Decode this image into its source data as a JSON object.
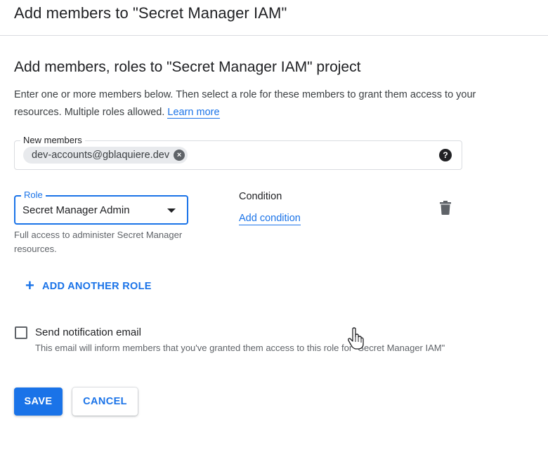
{
  "header": {
    "title": "Add members to \"Secret Manager IAM\""
  },
  "section": {
    "title": "Add members, roles to \"Secret Manager IAM\" project",
    "description": "Enter one or more members below. Then select a role for these members to grant them access to your resources. Multiple roles allowed. ",
    "learn_more": "Learn more"
  },
  "members": {
    "label": "New members",
    "chips": [
      "dev-accounts@gblaquiere.dev"
    ],
    "help_icon": "help-circle-icon"
  },
  "role": {
    "label": "Role",
    "selected": "Secret Manager Admin",
    "help": "Full access to administer Secret Manager resources."
  },
  "condition": {
    "label": "Condition",
    "add_link": "Add condition"
  },
  "add_role_label": "ADD ANOTHER ROLE",
  "notification": {
    "label": "Send notification email",
    "help": "This email will inform members that you've granted them access to this role for \"Secret Manager IAM\"",
    "checked": false
  },
  "buttons": {
    "save": "SAVE",
    "cancel": "CANCEL"
  },
  "colors": {
    "accent": "#1a73e8",
    "text": "#202124",
    "muted": "#5f6368"
  }
}
